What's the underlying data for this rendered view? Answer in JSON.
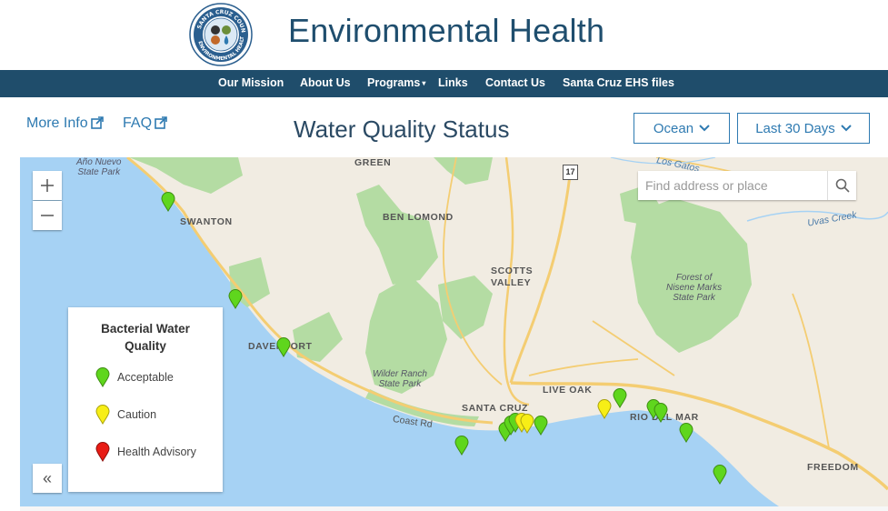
{
  "header": {
    "seal_text": "SANTA CRUZ COUNTY ENVIRONMENTAL HEALTH",
    "title": "Environmental Health"
  },
  "nav": {
    "items": [
      "Our Mission",
      "About Us",
      "Programs",
      "Links",
      "Contact Us",
      "Santa Cruz EHS files"
    ]
  },
  "toolbar": {
    "more_info": "More Info",
    "faq": "FAQ",
    "page_title": "Water Quality Status",
    "water_type": "Ocean",
    "time_range": "Last 30 Days"
  },
  "map": {
    "search_placeholder": "Find address or place",
    "highway": "17",
    "labels": {
      "swanton": "SWANTON",
      "ben_lomond": "BEN LOMOND",
      "scotts_valley_1": "SCOTTS",
      "scotts_valley_2": "VALLEY",
      "davenport": "DAVENPORT",
      "santa_cruz": "SANTA CRUZ",
      "live_oak": "LIVE OAK",
      "rio_del_mar": "RIO DEL MAR",
      "freedom": "FREEDOM",
      "greeno": "GREEN",
      "park_top_1": "Año Nuevo",
      "park_top_2": "State Park",
      "wilder_1": "Wilder Ranch",
      "wilder_2": "State Park",
      "nisene_1": "Forest of",
      "nisene_2": "Nisene Marks",
      "nisene_3": "State Park",
      "coast_rd": "Coast Rd",
      "uvas_creek": "Uvas Creek",
      "los_gatos": "Los Gatos"
    },
    "markers": [
      {
        "status": "acceptable"
      },
      {
        "status": "acceptable"
      },
      {
        "status": "acceptable"
      },
      {
        "status": "acceptable"
      },
      {
        "status": "acceptable"
      },
      {
        "status": "acceptable"
      },
      {
        "status": "acceptable"
      },
      {
        "status": "caution"
      },
      {
        "status": "caution"
      },
      {
        "status": "acceptable"
      },
      {
        "status": "caution"
      },
      {
        "status": "acceptable"
      },
      {
        "status": "acceptable"
      },
      {
        "status": "acceptable"
      },
      {
        "status": "acceptable"
      },
      {
        "status": "acceptable"
      }
    ]
  },
  "legend": {
    "title_line1": "Bacterial Water",
    "title_line2": "Quality",
    "items": [
      {
        "label": "Acceptable",
        "color": "#5fd61d"
      },
      {
        "label": "Caution",
        "color": "#f7ee16"
      },
      {
        "label": "Health Advisory",
        "color": "#e81b14"
      }
    ]
  },
  "colors": {
    "navbar": "#1f4d6b",
    "accent": "#2e7ab1",
    "ocean": "#a6d2f4",
    "land": "#f1ece2",
    "park": "#b4dca3",
    "road": "#f4cd72"
  }
}
